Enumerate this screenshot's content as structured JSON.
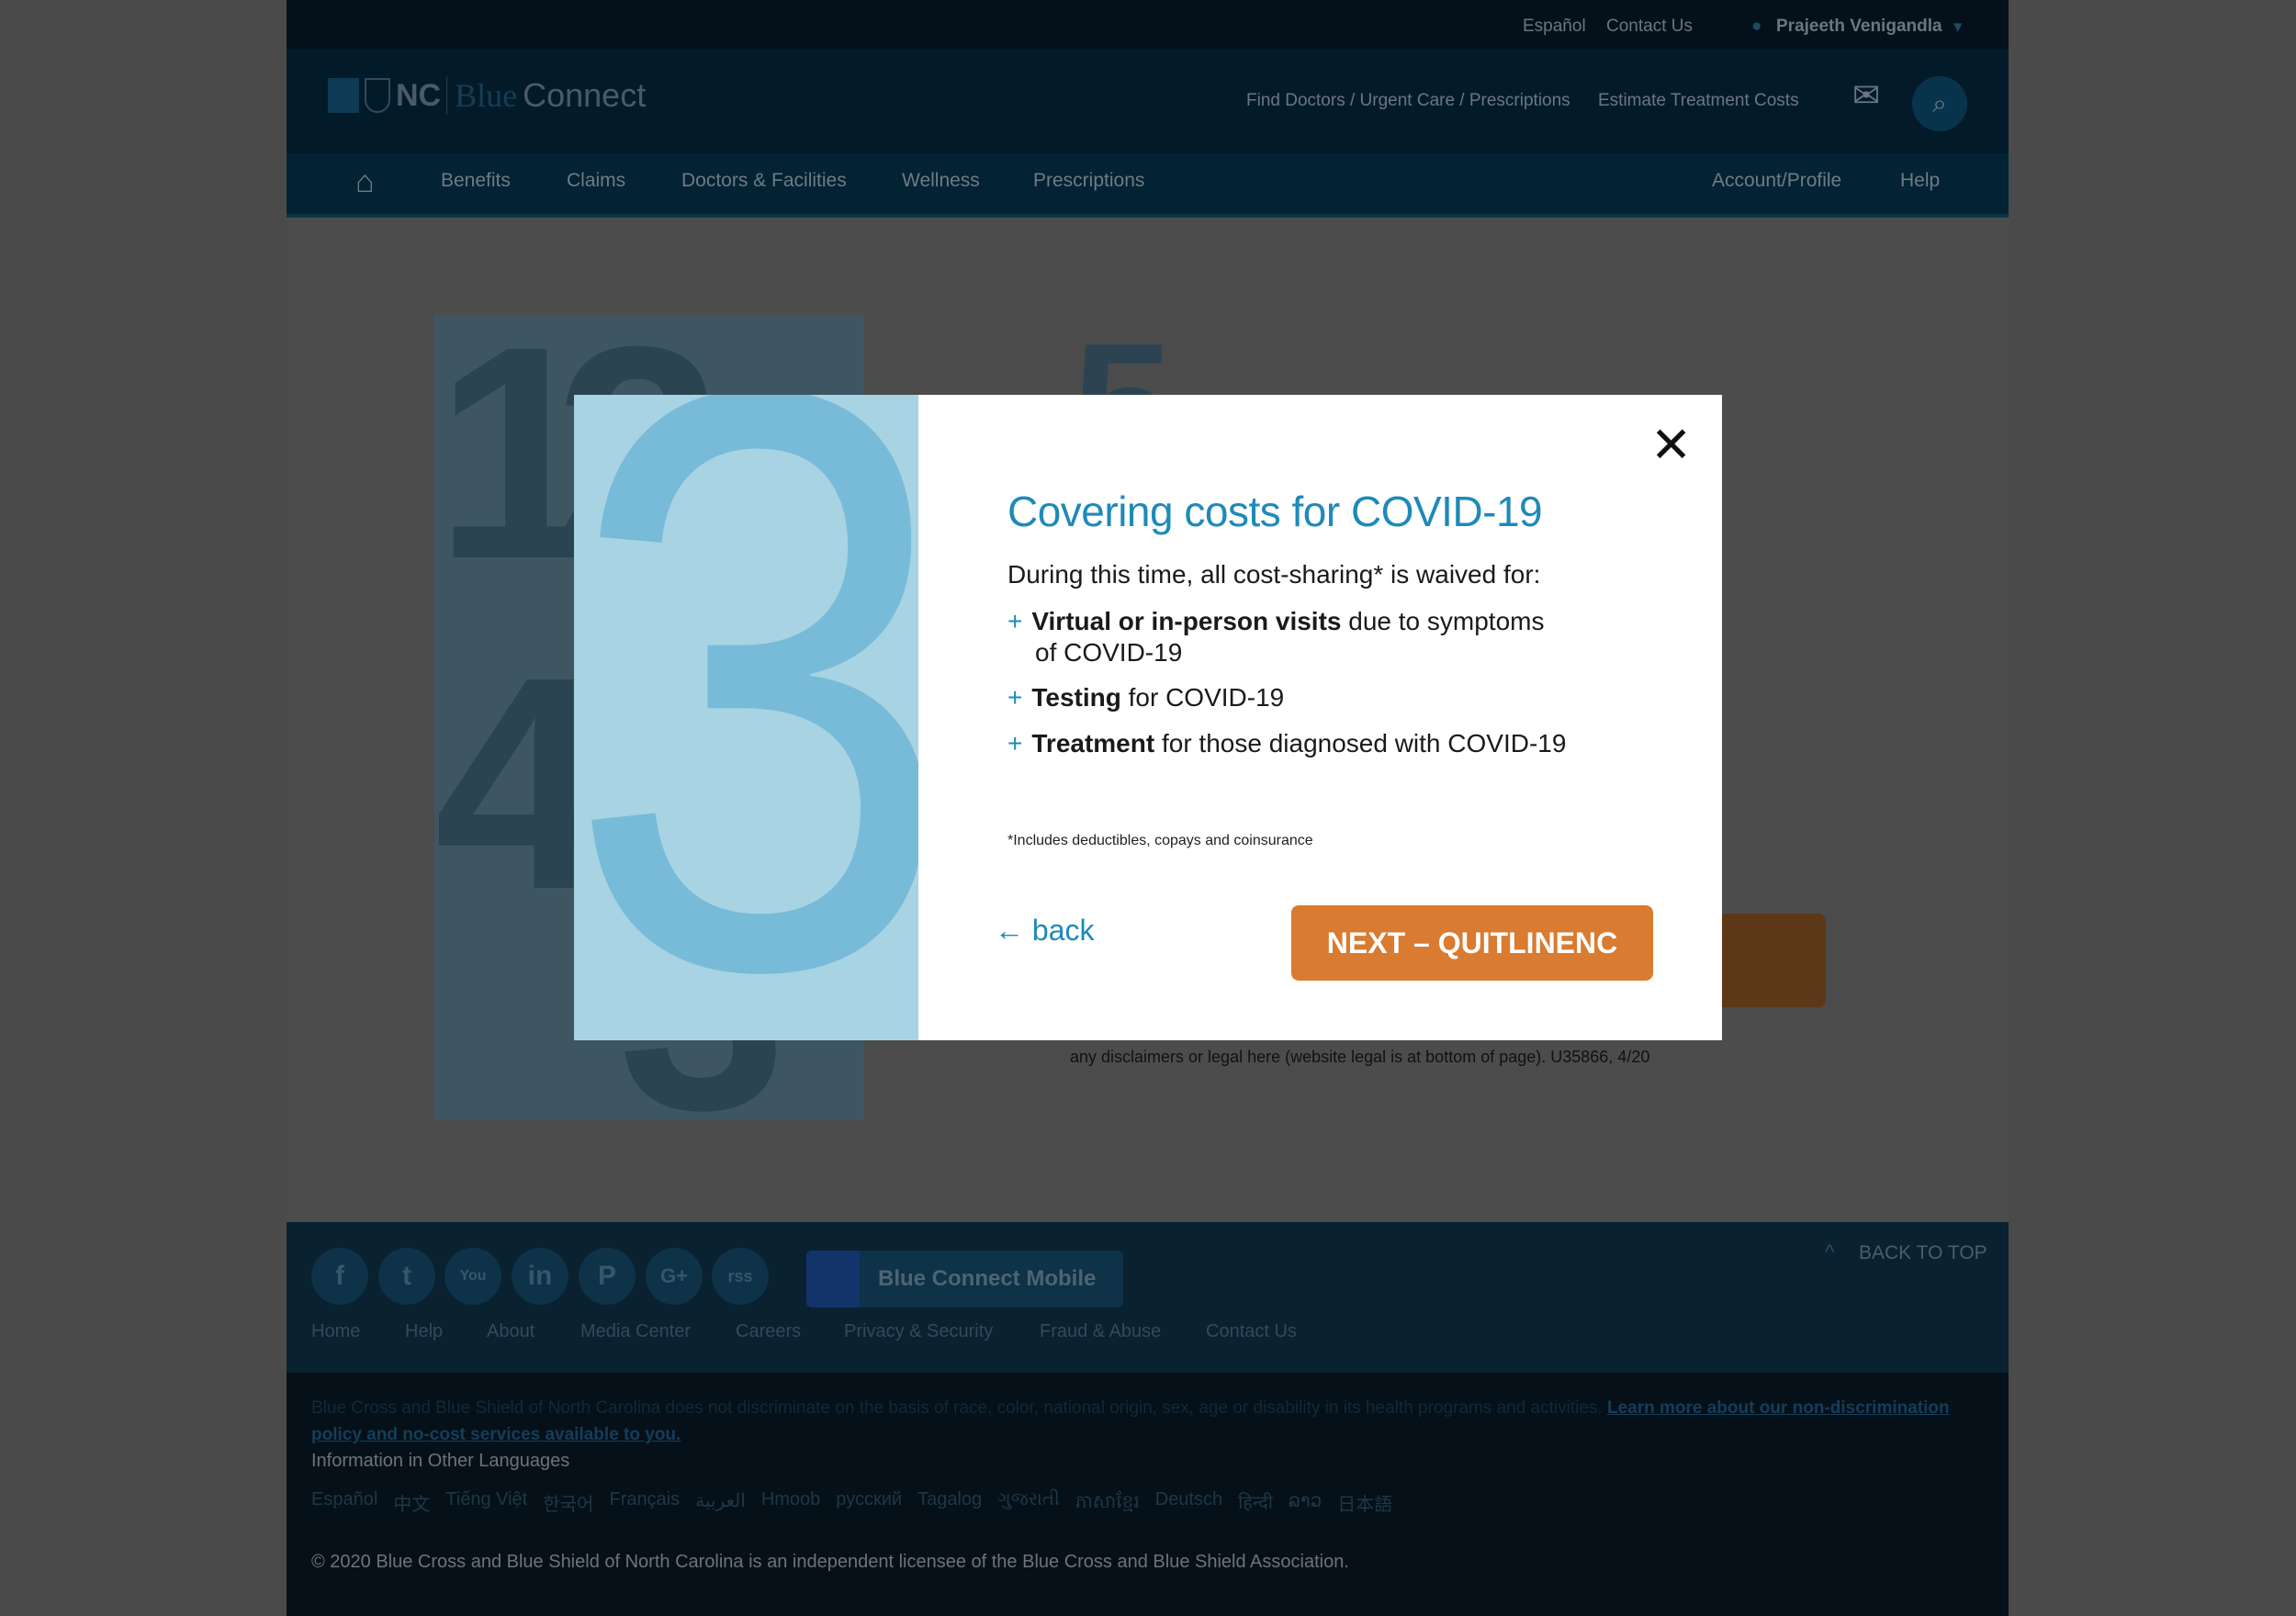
{
  "topbar": {
    "espanol": "Español",
    "contact": "Contact Us",
    "user": "Prajeeth Venigandla"
  },
  "header": {
    "logo_nc": "NC",
    "logo_blue": "Blue",
    "logo_connect": "Connect",
    "find": "Find Doctors / Urgent Care / Prescriptions",
    "estimate": "Estimate Treatment Costs"
  },
  "nav": {
    "items": [
      "Benefits",
      "Claims",
      "Doctors & Facilities",
      "Wellness",
      "Prescriptions"
    ],
    "account": "Account/Profile",
    "help": "Help"
  },
  "background": {
    "disclaimer": "any disclaimers or legal here (website legal is at bottom of page). U35866, 4/20",
    "digits": [
      "1",
      "2",
      "4",
      "3",
      "5"
    ]
  },
  "modal": {
    "image_digit": "3",
    "title": "Covering costs for COVID-19",
    "intro": "During this time, all cost-sharing* is waived for:",
    "items": [
      {
        "bold": "Virtual or in-person visits",
        "rest": " due to symptoms",
        "cont": "of COVID-19"
      },
      {
        "bold": "Testing",
        "rest": " for COVID-19"
      },
      {
        "bold": "Treatment",
        "rest": " for those diagnosed with COVID-19"
      }
    ],
    "plus": "+",
    "footnote": "*Includes deductibles, copays and coinsurance",
    "back": "← back",
    "next": "NEXT – QUITLINENC",
    "close": "✕"
  },
  "footer": {
    "back_to_top": "BACK TO TOP",
    "mobile": "Blue Connect Mobile",
    "social": [
      "f",
      "t",
      "You",
      "in",
      "P",
      "G+",
      "rss"
    ],
    "links": [
      "Home",
      "Help",
      "About",
      "Media Center",
      "Careers",
      "Privacy & Security",
      "Fraud & Abuse",
      "Contact Us"
    ],
    "nondiscrim": "Blue Cross and Blue Shield of North Carolina does not discriminate on the basis of race, color, national origin, sex, age or disability in its health programs and activities.",
    "nondiscrim_link": "Learn more about our non-discrimination policy and no-cost services available to you.",
    "other_lang": "Information in Other Languages",
    "languages": [
      "Español",
      "中文",
      "Tiếng Việt",
      "한국어",
      "Français",
      "العربية",
      "Hmoob",
      "русский",
      "Tagalog",
      "ગુજરાતી",
      "ភាសាខ្មែរ",
      "Deutsch",
      "हिन्दी",
      "ລາວ",
      "日本語"
    ],
    "copyright": "© 2020 Blue Cross and Blue Shield of North Carolina is an independent licensee of the Blue Cross and Blue Shield Association."
  },
  "colors": {
    "accent": "#1e8ab8",
    "button": "#d97b30",
    "overlay": "#4a4a4a"
  }
}
